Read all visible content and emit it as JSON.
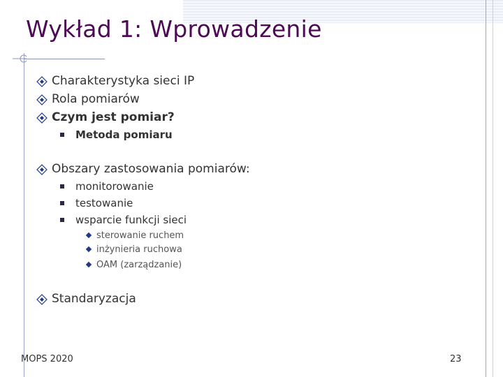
{
  "title": "Wykład 1: Wprowadzenie",
  "bullets": [
    {
      "text": "Charakterystyka sieci IP"
    },
    {
      "text": "Rola pomiarów"
    },
    {
      "text": "Czym jest pomiar?"
    },
    {
      "text": "Metoda pomiaru"
    },
    {
      "text": "Obszary zastosowania pomiarów:"
    },
    {
      "text": "monitorowanie"
    },
    {
      "text": "testowanie"
    },
    {
      "text": "wsparcie funkcji sieci"
    },
    {
      "text": "sterowanie ruchem"
    },
    {
      "text": "inżynieria ruchowa"
    },
    {
      "text": "OAM (zarządzanie)"
    },
    {
      "text": "Standaryzacja"
    }
  ],
  "footer": {
    "left": "MOPS 2020",
    "page_number": "23"
  },
  "colors": {
    "title": "#4d0a55",
    "bullet_diamond": "#1f3a8a",
    "text": "#333333"
  },
  "icons": {
    "level1": "diamond-icon",
    "level2": "square-icon",
    "level3": "small-diamond-icon"
  }
}
